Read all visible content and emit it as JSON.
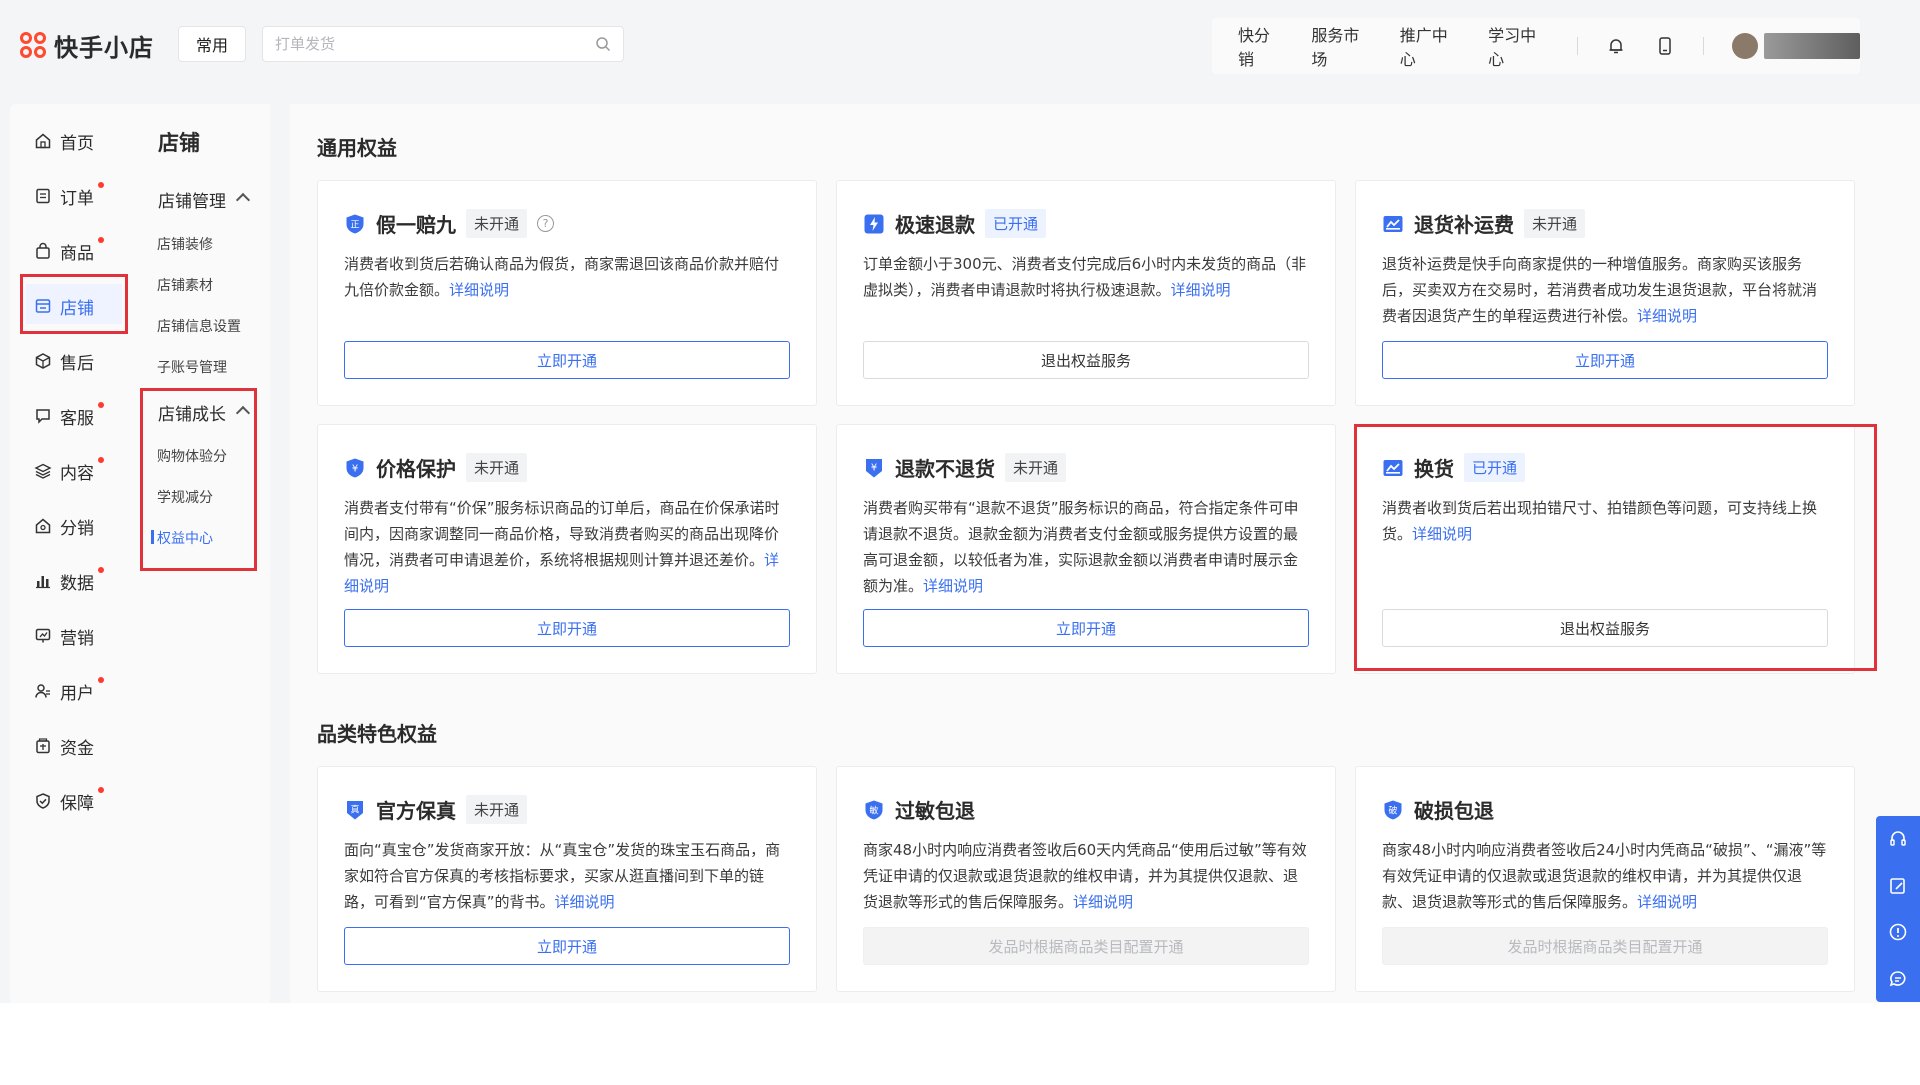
{
  "app": {
    "logo_text": "快手小店",
    "common_label": "常用",
    "search_placeholder": "打单发货"
  },
  "topnav": {
    "items": [
      "快分销",
      "服务市场",
      "推广中心",
      "学习中心"
    ]
  },
  "sidebar": {
    "items": [
      {
        "label": "首页",
        "dot": false
      },
      {
        "label": "订单",
        "dot": true
      },
      {
        "label": "商品",
        "dot": true
      },
      {
        "label": "店铺",
        "dot": false
      },
      {
        "label": "售后",
        "dot": false
      },
      {
        "label": "客服",
        "dot": true
      },
      {
        "label": "内容",
        "dot": true
      },
      {
        "label": "分销",
        "dot": false
      },
      {
        "label": "数据",
        "dot": true
      },
      {
        "label": "营销",
        "dot": false
      },
      {
        "label": "用户",
        "dot": true
      },
      {
        "label": "资金",
        "dot": false
      },
      {
        "label": "保障",
        "dot": true
      }
    ],
    "active": "店铺"
  },
  "subnav": {
    "title": "店铺",
    "groups": [
      {
        "label": "店铺管理",
        "items": [
          "店铺装修",
          "店铺素材",
          "店铺信息设置",
          "子账号管理"
        ]
      },
      {
        "label": "店铺成长",
        "items": [
          "购物体验分",
          "学规减分",
          "权益中心"
        ]
      }
    ],
    "active": "权益中心"
  },
  "sections": {
    "general": "通用权益",
    "category": "品类特色权益"
  },
  "link_text": "详细说明",
  "cards": [
    {
      "title": "假一赔九",
      "badge": "未开通",
      "badge_on": false,
      "help": true,
      "desc": "消费者收到货后若确认商品为假货，商家需退回该商品价款并赔付九倍价款金额。",
      "button": "立即开通",
      "btn_type": "primary"
    },
    {
      "title": "极速退款",
      "badge": "已开通",
      "badge_on": true,
      "help": false,
      "desc": "订单金额小于300元、消费者支付完成后6小时内未发货的商品（非虚拟类），消费者申请退款时将执行极速退款。",
      "button": "退出权益服务",
      "btn_type": "plain"
    },
    {
      "title": "退货补运费",
      "badge": "未开通",
      "badge_on": false,
      "help": false,
      "desc": "退货补运费是快手向商家提供的一种增值服务。商家购买该服务后，买卖双方在交易时，若消费者成功发生退货退款，平台将就消费者因退货产生的单程运费进行补偿。",
      "button": "立即开通",
      "btn_type": "primary"
    },
    {
      "title": "价格保护",
      "badge": "未开通",
      "badge_on": false,
      "help": false,
      "desc": "消费者支付带有“价保”服务标识商品的订单后，商品在价保承诺时间内，因商家调整同一商品价格，导致消费者购买的商品出现降价情况，消费者可申请退差价，系统将根据规则计算并退还差价。",
      "button": "立即开通",
      "btn_type": "primary"
    },
    {
      "title": "退款不退货",
      "badge": "未开通",
      "badge_on": false,
      "help": false,
      "desc": "消费者购买带有“退款不退货”服务标识的商品，符合指定条件可申请退款不退货。退款金额为消费者支付金额或服务提供方设置的最高可退金额，以较低者为准，实际退款金额以消费者申请时展示金额为准。",
      "button": "立即开通",
      "btn_type": "primary"
    },
    {
      "title": "换货",
      "badge": "已开通",
      "badge_on": true,
      "help": false,
      "desc": "消费者收到货后若出现拍错尺寸、拍错颜色等问题，可支持线上换货。",
      "button": "退出权益服务",
      "btn_type": "plain"
    },
    {
      "title": "官方保真",
      "badge": "未开通",
      "badge_on": false,
      "help": false,
      "desc": "面向“真宝仓”发货商家开放：从“真宝仓”发货的珠宝玉石商品，商家如符合官方保真的考核指标要求，买家从逛直播间到下单的链路，可看到“官方保真”的背书。",
      "button": "立即开通",
      "btn_type": "primary"
    },
    {
      "title": "过敏包退",
      "badge": "",
      "badge_on": false,
      "help": false,
      "desc": "商家48小时内响应消费者签收后60天内凭商品“使用后过敏”等有效凭证申请的仅退款或退货退款的维权申请，并为其提供仅退款、退货退款等形式的售后保障服务。",
      "button": "发品时根据商品类目配置开通",
      "btn_type": "disabled"
    },
    {
      "title": "破损包退",
      "badge": "",
      "badge_on": false,
      "help": false,
      "desc": "商家48小时内响应消费者签收后24小时内凭商品“破损”、“漏液”等有效凭证申请的仅退款或退货退款的维权申请，并为其提供仅退款、退货退款等形式的售后保障服务。",
      "button": "发品时根据商品类目配置开通",
      "btn_type": "disabled"
    }
  ],
  "colors": {
    "accent": "#3a6ff0",
    "highlight": "#e0323a",
    "brand": "#ff4a2e"
  }
}
